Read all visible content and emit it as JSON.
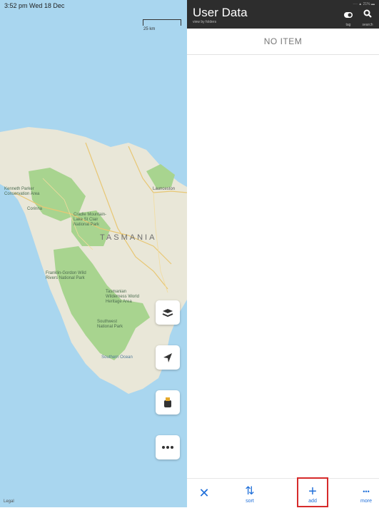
{
  "status_bar": {
    "time": "3:52 pm  Wed 18 Dec",
    "system": "···· ▲ 21% ▬"
  },
  "map": {
    "scale_label": "25 km",
    "labels": {
      "conservation": "Kenneth Parker Conservation Area",
      "cradle": "Cradle Mountain-Lake St Clair National Park",
      "tasmania": "TASMANIA",
      "launceston": "Launceston",
      "franklin": "Franklin-Gordon Wild Rivers National Park",
      "wilderness": "Tasmanian Wilderness World Heritage Area",
      "southwest": "Southwest National Park",
      "ocean": "Southern Ocean",
      "corinna": "Corinna"
    },
    "controls": [
      "layers-icon",
      "location-arrow-icon",
      "binoculars-icon",
      "more-icon"
    ],
    "legal": "Legal"
  },
  "panel": {
    "title": "User Data",
    "subtitle": "view by folders",
    "toolbar": {
      "tag_label": "tag",
      "search_label": "search"
    },
    "empty_text": "NO ITEM",
    "bottom": {
      "close_glyph": "✕",
      "sort_glyph": "⇅",
      "sort_label": "sort",
      "add_glyph": "+",
      "add_label": "add",
      "more_glyph": "•••",
      "more_label": "more"
    }
  },
  "colors": {
    "accent": "#1f6fd9",
    "topbar": "#2d2d2d",
    "sea": "#a9d6ef",
    "land": "#e9e7d8",
    "park": "#a8d48f",
    "highlight": "#d62a2a"
  }
}
